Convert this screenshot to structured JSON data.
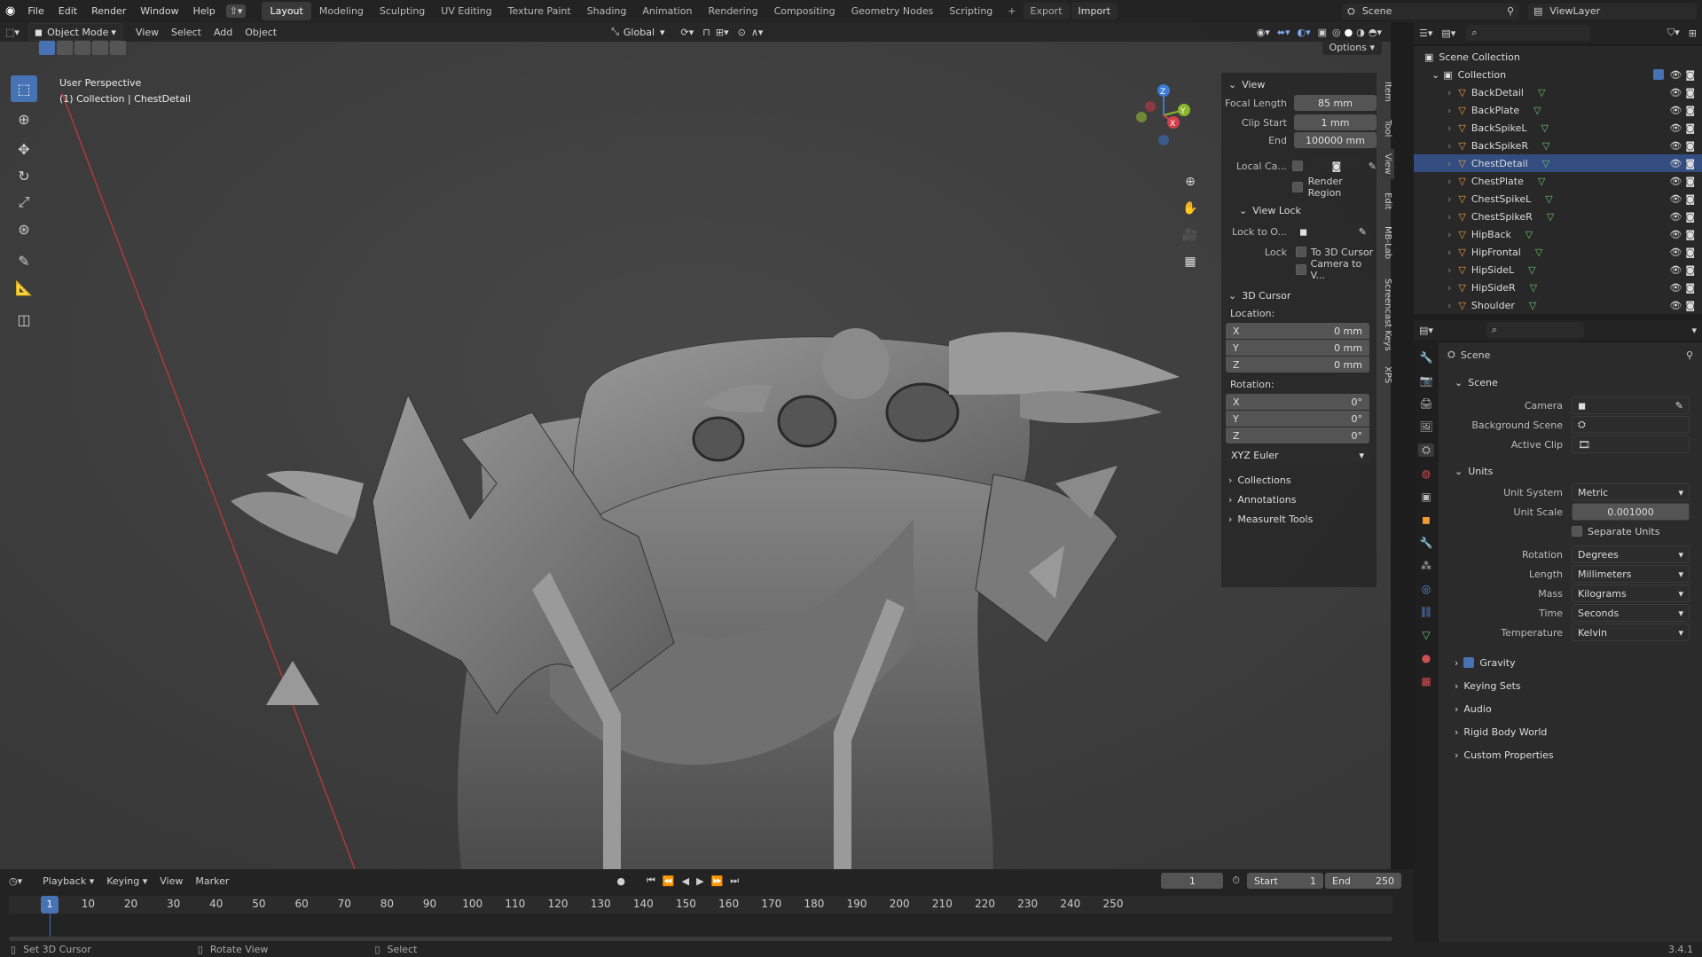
{
  "topbar": {
    "menus": [
      "File",
      "Edit",
      "Render",
      "Window",
      "Help"
    ],
    "workspaces": [
      "Layout",
      "Modeling",
      "Sculpting",
      "UV Editing",
      "Texture Paint",
      "Shading",
      "Animation",
      "Rendering",
      "Compositing",
      "Geometry Nodes",
      "Scripting"
    ],
    "active_workspace": "Layout",
    "export_label": "Export",
    "import_label": "Import",
    "scene_name": "Scene",
    "view_layer": "ViewLayer"
  },
  "viewport": {
    "mode": "Object Mode",
    "menus": [
      "View",
      "Select",
      "Add",
      "Object"
    ],
    "orientation": "Global",
    "options_label": "Options",
    "overlay_title": "User Perspective",
    "overlay_subtitle": "(1) Collection | ChestDetail",
    "gizmo_axes": [
      "Z",
      "Y",
      "X"
    ]
  },
  "npanel": {
    "view_section": "View",
    "focal_length_label": "Focal Length",
    "focal_length": "85 mm",
    "clip_start_label": "Clip Start",
    "clip_start": "1 mm",
    "end_label": "End",
    "clip_end": "100000 mm",
    "local_camera_label": "Local Ca...",
    "render_region_label": "Render Region",
    "view_lock_section": "View Lock",
    "lock_to_object_label": "Lock to O...",
    "lock_label": "Lock",
    "to_3d_cursor_label": "To 3D Cursor",
    "camera_to_view_label": "Camera to V...",
    "cursor_section": "3D Cursor",
    "location_label": "Location:",
    "location": [
      {
        "axis": "X",
        "value": "0 mm"
      },
      {
        "axis": "Y",
        "value": "0 mm"
      },
      {
        "axis": "Z",
        "value": "0 mm"
      }
    ],
    "rotation_label": "Rotation:",
    "rotation": [
      {
        "axis": "X",
        "value": "0°"
      },
      {
        "axis": "Y",
        "value": "0°"
      },
      {
        "axis": "Z",
        "value": "0°"
      }
    ],
    "rotation_mode": "XYZ Euler",
    "collapsed": [
      "Collections",
      "Annotations",
      "MeasureIt Tools"
    ],
    "tabs": [
      "Item",
      "Tool",
      "View",
      "Edit",
      "MB-Lab",
      "Screencast Keys",
      "XPS"
    ]
  },
  "outliner": {
    "root": "Scene Collection",
    "collection": "Collection",
    "objects": [
      "BackDetail",
      "BackPlate",
      "BackSpikeL",
      "BackSpikeR",
      "ChestDetail",
      "ChestPlate",
      "ChestSpikeL",
      "ChestSpikeR",
      "HipBack",
      "HipFrontal",
      "HipSideL",
      "HipSideR",
      "Shoulder"
    ],
    "selected": "ChestDetail"
  },
  "properties": {
    "context": "Scene",
    "scene_section": "Scene",
    "camera_label": "Camera",
    "background_scene_label": "Background Scene",
    "active_clip_label": "Active Clip",
    "units_section": "Units",
    "unit_system_label": "Unit System",
    "unit_system": "Metric",
    "unit_scale_label": "Unit Scale",
    "unit_scale": "0.001000",
    "separate_units_label": "Separate Units",
    "rotation_label": "Rotation",
    "rotation": "Degrees",
    "length_label": "Length",
    "length": "Millimeters",
    "mass_label": "Mass",
    "mass": "Kilograms",
    "time_label": "Time",
    "time": "Seconds",
    "temperature_label": "Temperature",
    "temperature": "Kelvin",
    "gravity_label": "Gravity",
    "collapsed": [
      "Keying Sets",
      "Audio",
      "Rigid Body World",
      "Custom Properties"
    ]
  },
  "timeline": {
    "menus": [
      "Playback",
      "Keying",
      "View",
      "Marker"
    ],
    "current_frame": "1",
    "start_label": "Start",
    "start": "1",
    "end_label": "End",
    "end": "250",
    "ticks": [
      "1",
      "10",
      "20",
      "30",
      "40",
      "50",
      "60",
      "70",
      "80",
      "90",
      "100",
      "110",
      "120",
      "130",
      "140",
      "150",
      "160",
      "170",
      "180",
      "190",
      "200",
      "210",
      "220",
      "230",
      "240",
      "250"
    ]
  },
  "statusbar": {
    "hint1": "Set 3D Cursor",
    "hint2": "Rotate View",
    "hint3": "Select",
    "version": "3.4.1"
  },
  "colors": {
    "accent": "#4772b3",
    "selected_row": "#334d80",
    "object_icon": "#f29b36",
    "mesh_icon": "#69c76a"
  }
}
